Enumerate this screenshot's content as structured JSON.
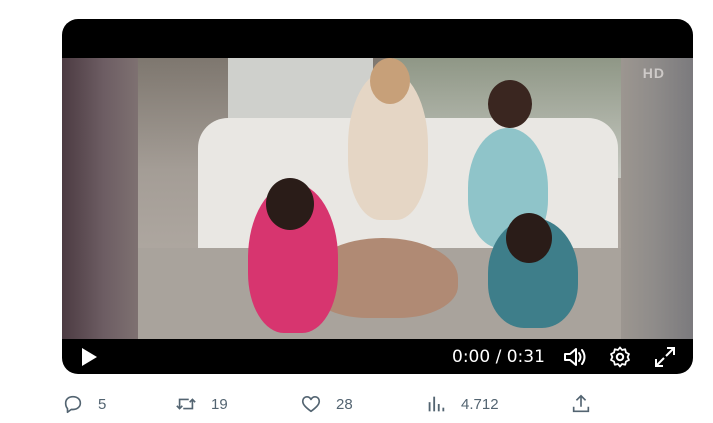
{
  "video": {
    "current_time": "0:00",
    "duration": "0:31",
    "time_display": "0:00 / 0:31",
    "progress": 0.0,
    "channel_badge": "HD"
  },
  "actions": {
    "replies": "5",
    "retweets": "19",
    "likes": "28",
    "views": "4.712"
  },
  "icons": {
    "play": "play-icon",
    "volume": "volume-icon",
    "settings": "gear-icon",
    "fullscreen": "fullscreen-icon",
    "reply": "reply-icon",
    "retweet": "retweet-icon",
    "like": "heart-icon",
    "views": "analytics-icon",
    "share": "share-icon"
  },
  "colors": {
    "action_text": "#536471",
    "player_bg": "#000000",
    "control_fg": "#ffffff"
  }
}
